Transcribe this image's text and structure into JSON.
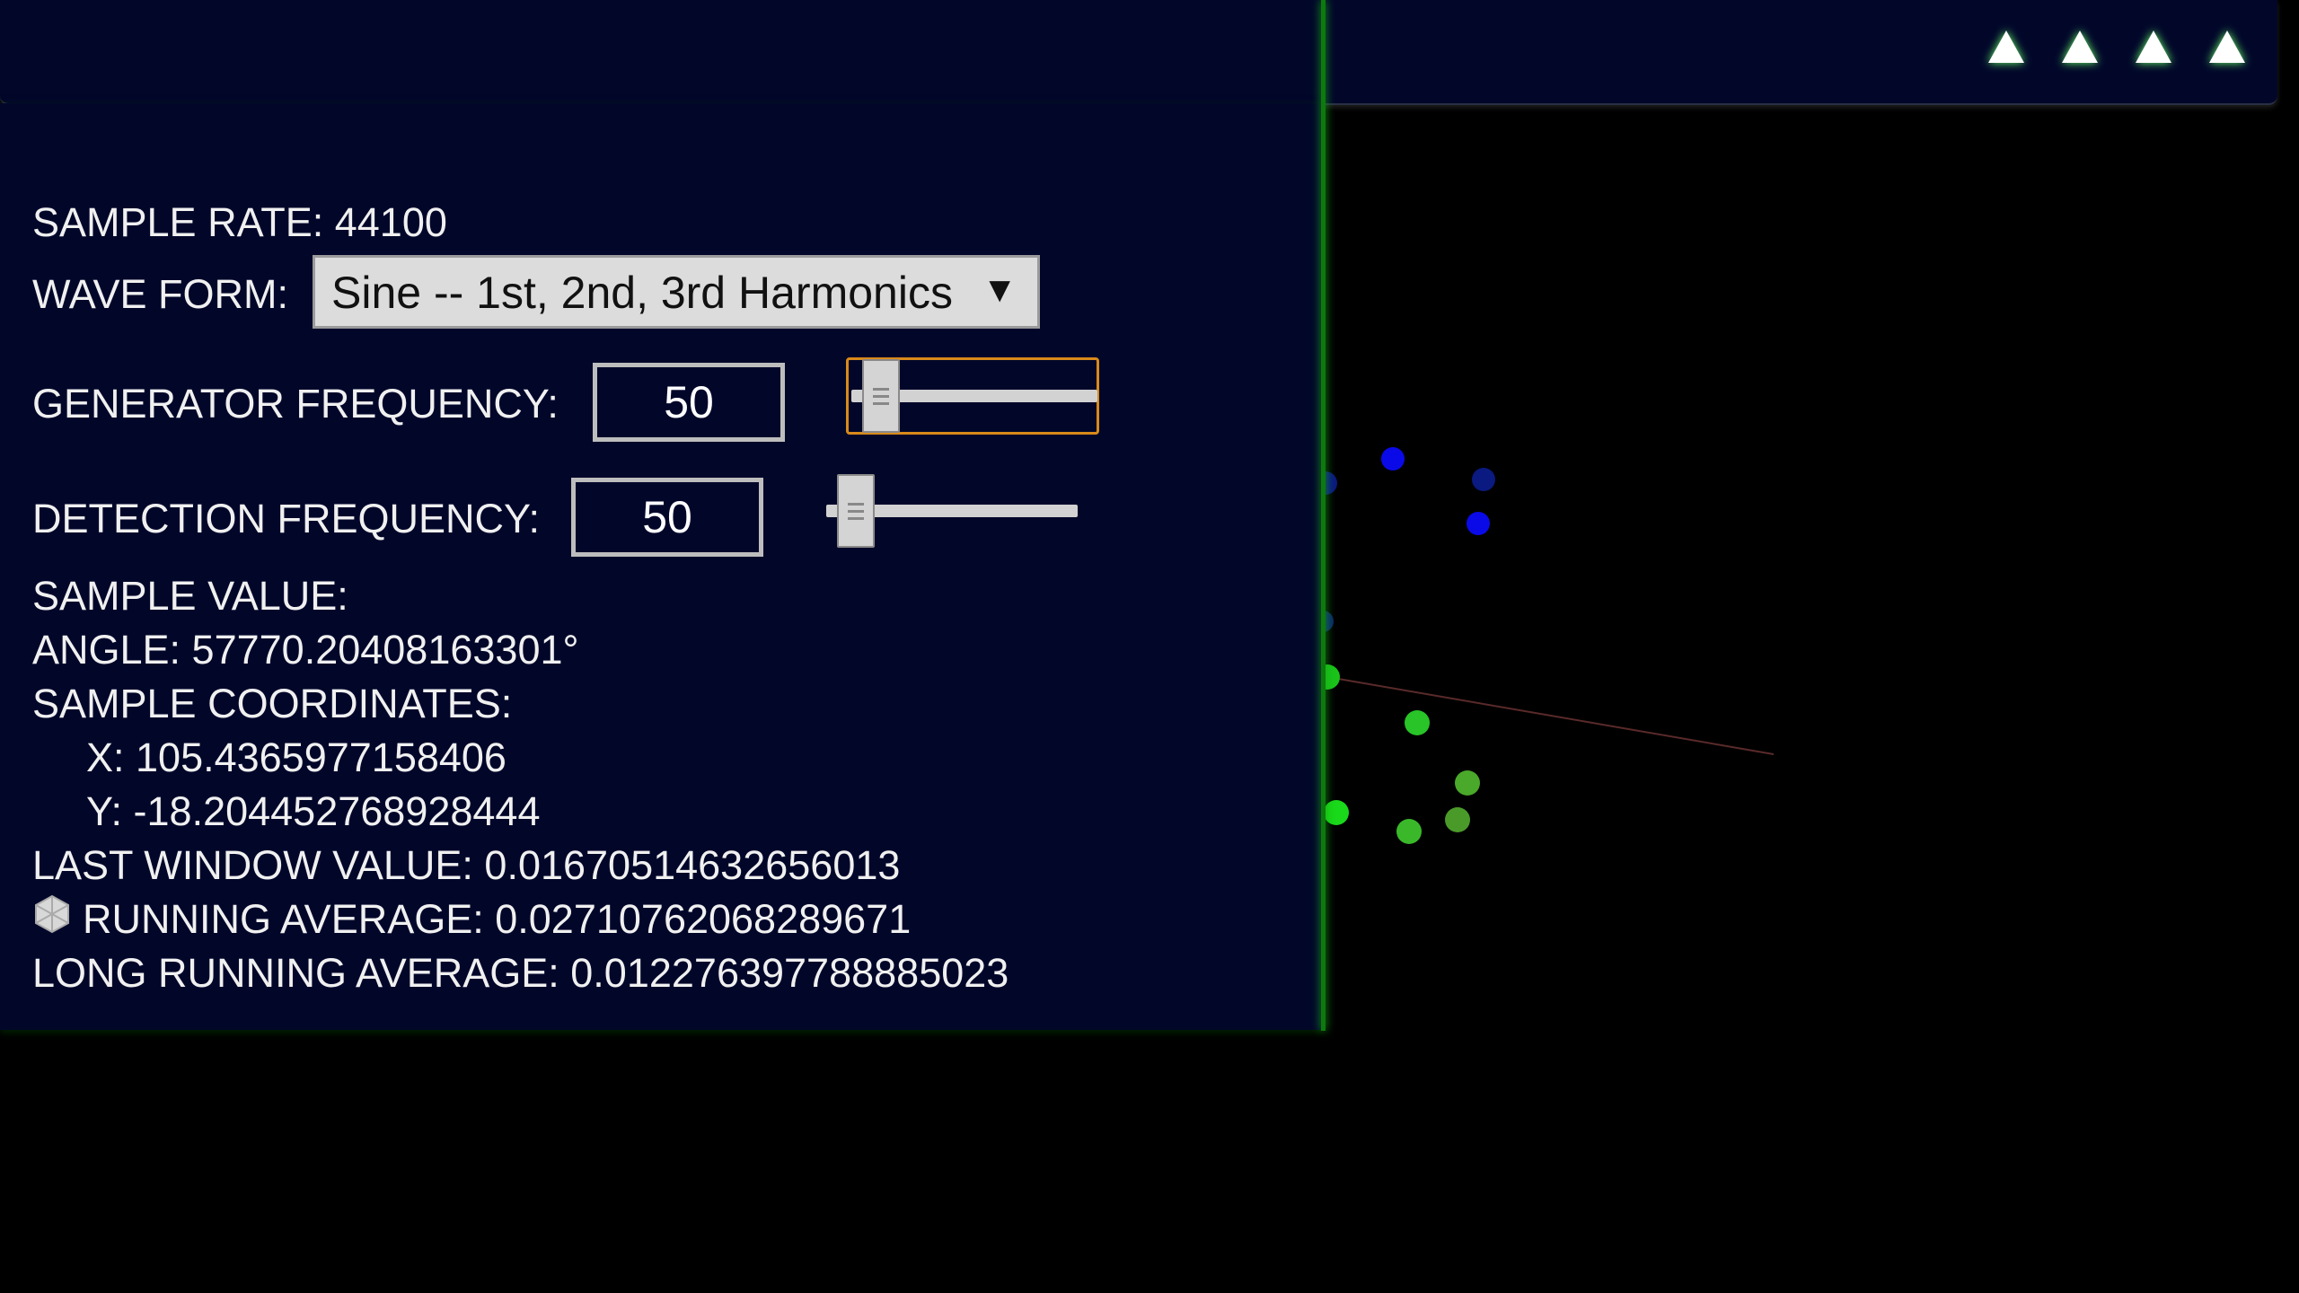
{
  "top_bar": {
    "buttons": [
      {
        "icon": "triangle-up-icon"
      },
      {
        "icon": "triangle-up-icon"
      },
      {
        "icon": "triangle-up-icon"
      },
      {
        "icon": "triangle-up-icon"
      }
    ]
  },
  "panel": {
    "sample_rate": "SAMPLE RATE: 44100",
    "wave_form_label": "WAVE FORM:",
    "wave_form_value": "Sine -- 1st, 2nd, 3rd Harmonics",
    "wave_form_arrow": "▼",
    "generator_label": "GENERATOR FREQUENCY:",
    "generator_value": "50",
    "generator_slider": 0.05,
    "detection_label": "DETECTION FREQUENCY:",
    "detection_value": "50",
    "detection_slider": 0.05,
    "sample_value": "SAMPLE VALUE:",
    "angle": "ANGLE: 57770.20408163301°",
    "sample_coordinates": "SAMPLE COORDINATES:",
    "x": "X: 105.4365977158406",
    "y": "Y: -18.204452768928444",
    "last_window_value": "LAST WINDOW VALUE: 0.016705146326560​13",
    "running_average": "RUNNING AVERAGE: 0.02710762068289671",
    "long_running_average": "LONG RUNNING AVERAGE: 0.012276397788885023",
    "running_average_icon": "hexagon-icon"
  },
  "colors": {
    "panel_bg": "#02072a",
    "accent_focus": "#d98a1a",
    "divider_green": "#0d7a0d",
    "point_blue": "#0a14e6",
    "point_green": "#3ad92a"
  }
}
